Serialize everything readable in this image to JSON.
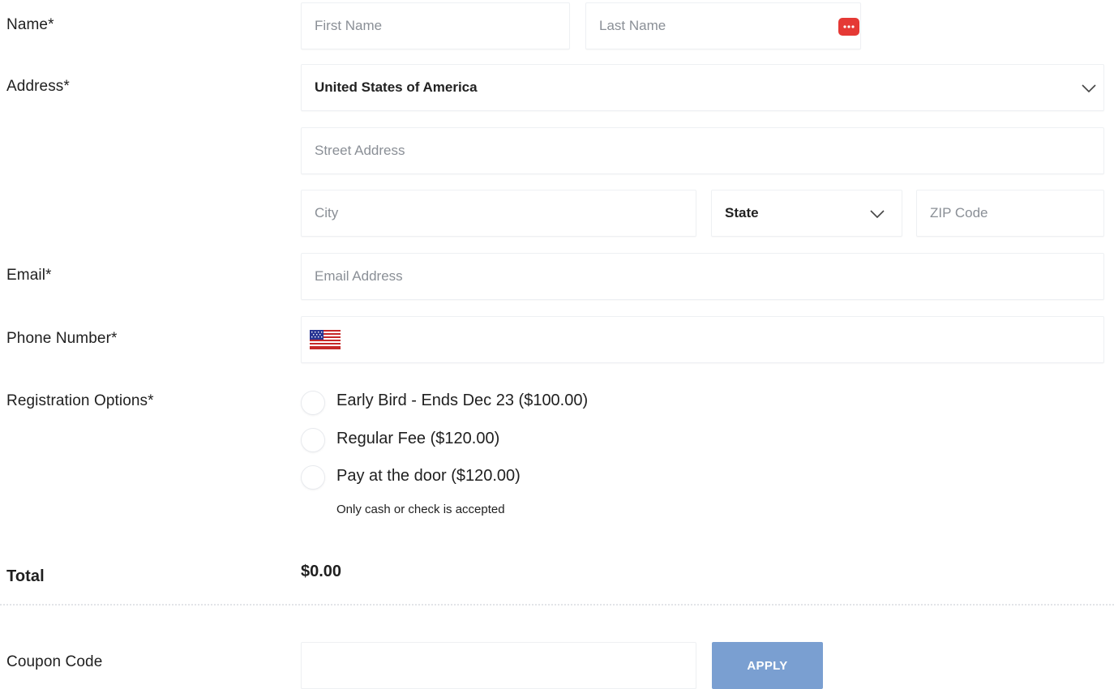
{
  "labels": {
    "name": "Name*",
    "address": "Address*",
    "email": "Email*",
    "phone": "Phone Number*",
    "registration": "Registration Options*",
    "total": "Total",
    "coupon": "Coupon Code"
  },
  "fields": {
    "first_name_placeholder": "First Name",
    "last_name_placeholder": "Last Name",
    "country_value": "United States of America",
    "street_placeholder": "Street Address",
    "city_placeholder": "City",
    "state_value": "State",
    "zip_placeholder": "ZIP Code",
    "email_placeholder": "Email Address",
    "phone_country_icon": "us-flag-icon",
    "coupon_value": ""
  },
  "registration_options": [
    {
      "label": "Early Bird - Ends Dec 23 ($100.00)",
      "selected": false
    },
    {
      "label": "Regular Fee ($120.00)",
      "selected": false
    },
    {
      "label": "Pay at the door ($120.00)",
      "selected": false
    }
  ],
  "registration_note": "Only cash or check is accepted",
  "total_value": "$0.00",
  "apply_label": "APPLY",
  "colors": {
    "apply_button": "#7a9fd1",
    "autofill_badge": "#e53935"
  }
}
